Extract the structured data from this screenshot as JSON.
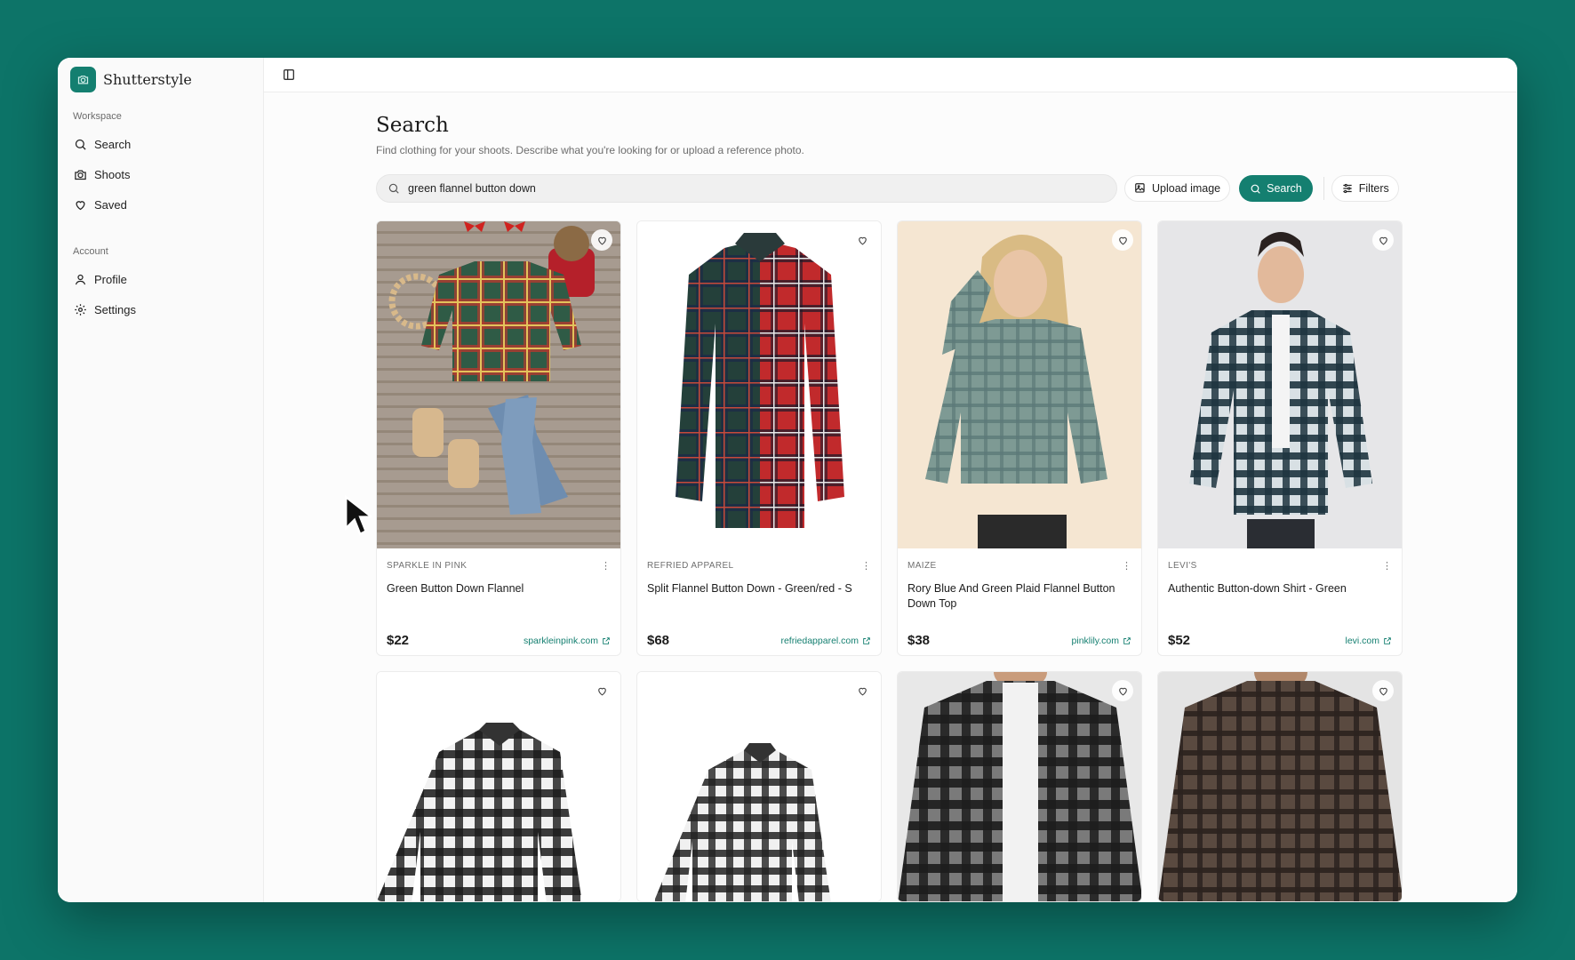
{
  "app": {
    "name": "Shutterstyle"
  },
  "sidebar": {
    "workspace_label": "Workspace",
    "workspace_items": [
      {
        "label": "Search",
        "icon": "search-icon"
      },
      {
        "label": "Shoots",
        "icon": "camera-icon"
      },
      {
        "label": "Saved",
        "icon": "heart-icon"
      }
    ],
    "account_label": "Account",
    "account_items": [
      {
        "label": "Profile",
        "icon": "user-icon"
      },
      {
        "label": "Settings",
        "icon": "gear-icon"
      }
    ]
  },
  "page": {
    "title": "Search",
    "subtitle": "Find clothing for your shoots. Describe what you're looking for or upload a reference photo."
  },
  "search": {
    "value": "green flannel button down",
    "upload_label": "Upload image",
    "search_label": "Search",
    "filters_label": "Filters"
  },
  "colors": {
    "accent": "#147f70",
    "background": "#0d7468"
  },
  "results": [
    {
      "brand": "SPARKLE IN PINK",
      "title": "Green Button Down Flannel",
      "price": "$22",
      "source": "sparkleinpink.com"
    },
    {
      "brand": "REFRIED APPAREL",
      "title": "Split Flannel Button Down - Green/red - S",
      "price": "$68",
      "source": "refriedapparel.com"
    },
    {
      "brand": "MAIZE",
      "title": "Rory Blue And Green Plaid Flannel Button Down Top",
      "price": "$38",
      "source": "pinklily.com"
    },
    {
      "brand": "LEVI'S",
      "title": "Authentic Button-down Shirt - Green",
      "price": "$52",
      "source": "levi.com"
    }
  ]
}
